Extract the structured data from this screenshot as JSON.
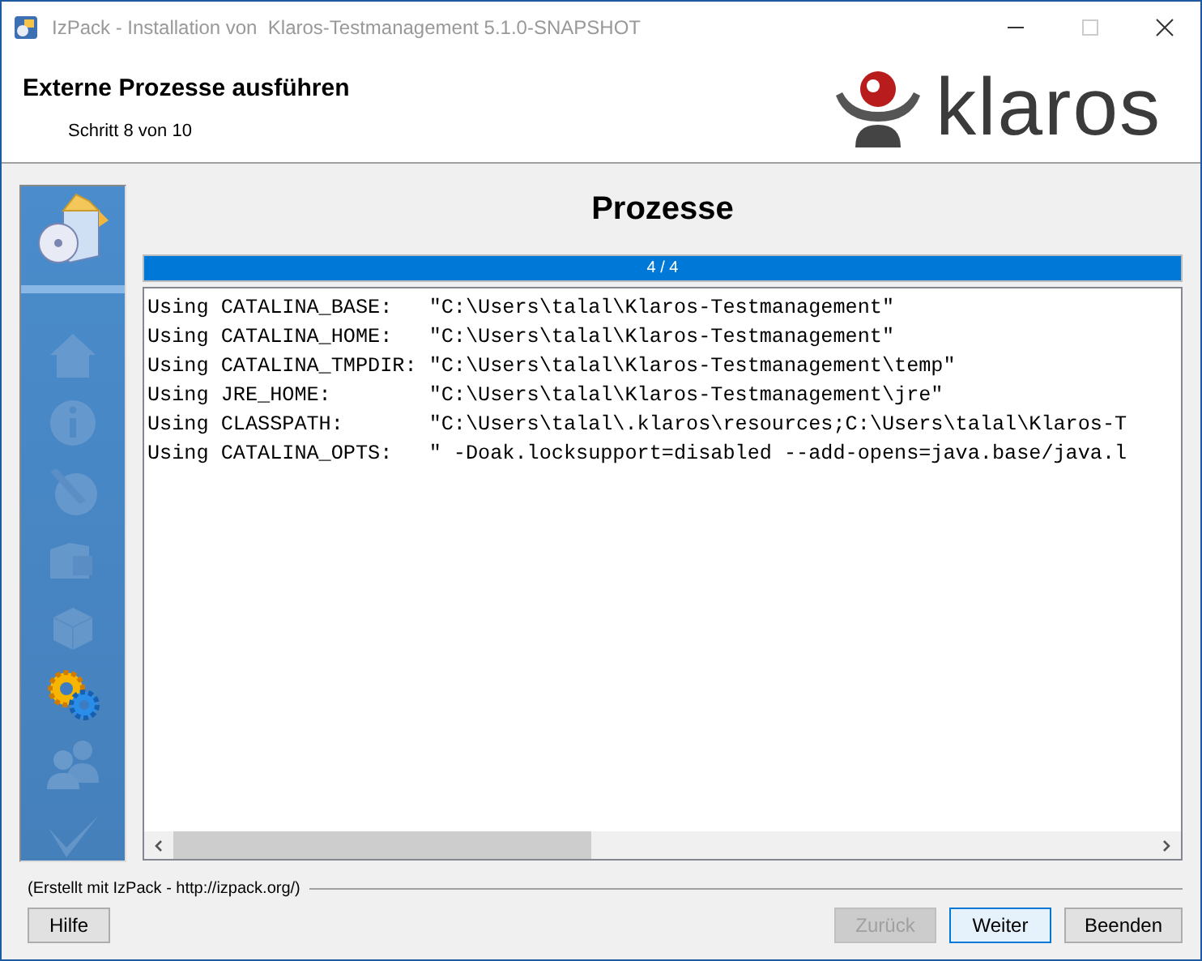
{
  "window": {
    "title": "IzPack - Installation von  Klaros-Testmanagement 5.1.0-SNAPSHOT",
    "controls": [
      {
        "kind": "minimize",
        "disabled": false
      },
      {
        "kind": "maximize",
        "disabled": true
      },
      {
        "kind": "close",
        "disabled": false
      }
    ]
  },
  "header": {
    "title": "Externe Prozesse ausführen",
    "step": "Schritt 8 von 10",
    "logo_text": "klaros"
  },
  "sidebar": {
    "steps": [
      {
        "kind": "home",
        "active": false
      },
      {
        "kind": "info",
        "active": false
      },
      {
        "kind": "license",
        "active": false
      },
      {
        "kind": "folders",
        "active": false
      },
      {
        "kind": "package",
        "active": false
      },
      {
        "kind": "gears",
        "active": true
      },
      {
        "kind": "users",
        "active": false
      },
      {
        "kind": "check",
        "active": false
      }
    ]
  },
  "panel": {
    "title": "Prozesse",
    "progress": {
      "label": "4 / 4",
      "level": 1.0
    },
    "log": [
      "Using CATALINA_BASE:   \"C:\\Users\\talal\\Klaros-Testmanagement\"",
      "Using CATALINA_HOME:   \"C:\\Users\\talal\\Klaros-Testmanagement\"",
      "Using CATALINA_TMPDIR: \"C:\\Users\\talal\\Klaros-Testmanagement\\temp\"",
      "Using JRE_HOME:        \"C:\\Users\\talal\\Klaros-Testmanagement\\jre\"",
      "Using CLASSPATH:       \"C:\\Users\\talal\\.klaros\\resources;C:\\Users\\talal\\Klaros-T",
      "Using CATALINA_OPTS:   \" -Doak.locksupport=disabled --add-opens=java.base/java.l"
    ]
  },
  "footer": {
    "credit": "(Erstellt mit IzPack - http://izpack.org/)",
    "left_buttons": [
      {
        "label": "Hilfe",
        "disabled": false,
        "focused": false
      }
    ],
    "right_buttons": [
      {
        "label": "Zurück",
        "disabled": true,
        "focused": false
      },
      {
        "label": "Weiter",
        "disabled": false,
        "focused": true
      },
      {
        "label": "Beenden",
        "disabled": false,
        "focused": false
      }
    ]
  }
}
